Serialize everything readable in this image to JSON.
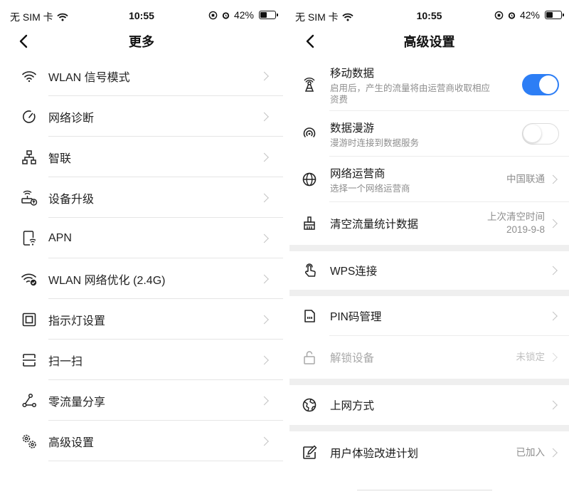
{
  "colors": {
    "accent": "#2d7ef5",
    "separator": "#efefef",
    "secondary_text": "#8e8e8e"
  },
  "left": {
    "status": {
      "carrier": "无 SIM 卡",
      "time": "10:55",
      "battery": "42%"
    },
    "title": "更多",
    "items": [
      {
        "label": "WLAN 信号模式",
        "icon": "wifi-icon"
      },
      {
        "label": "网络诊断",
        "icon": "diagnose-icon"
      },
      {
        "label": "智联",
        "icon": "topology-icon"
      },
      {
        "label": "设备升级",
        "icon": "router-upgrade-icon"
      },
      {
        "label": "APN",
        "icon": "apn-icon"
      },
      {
        "label": "WLAN 网络优化 (2.4G)",
        "icon": "wifi-optimize-icon"
      },
      {
        "label": "指示灯设置",
        "icon": "indicator-light-icon"
      },
      {
        "label": "扫一扫",
        "icon": "scan-icon"
      },
      {
        "label": "零流量分享",
        "icon": "share-icon"
      },
      {
        "label": "高级设置",
        "icon": "gears-icon"
      }
    ]
  },
  "right": {
    "status": {
      "carrier": "无 SIM 卡",
      "time": "10:55",
      "battery": "42%"
    },
    "title": "高级设置",
    "mobile_data": {
      "label": "移动数据",
      "desc": "启用后，产生的流量将由运营商收取相应资费",
      "desc_line1": "启用后，产生的流量将由运营商收取相应",
      "desc_line2": "资费",
      "enabled": true,
      "icon": "antenna-icon"
    },
    "roaming": {
      "label": "数据漫游",
      "desc": "漫游时连接到数据服务",
      "enabled": false,
      "icon": "roaming-icon"
    },
    "carrier": {
      "label": "网络运营商",
      "desc": "选择一个网络运营商",
      "value": "中国联通",
      "icon": "globe-icon"
    },
    "clear_stats": {
      "label": "清空流量统计数据",
      "value_line1": "上次清空时间",
      "value_line2": "2019-9-8",
      "icon": "broom-icon"
    },
    "wps": {
      "label": "WPS连接",
      "icon": "touch-icon"
    },
    "pin": {
      "label": "PIN码管理",
      "icon": "sim-card-icon"
    },
    "unlock": {
      "label": "解锁设备",
      "value": "未锁定",
      "icon": "unlock-icon"
    },
    "internet": {
      "label": "上网方式",
      "icon": "internet-globe-icon"
    },
    "ux": {
      "label": "用户体验改进计划",
      "value": "已加入",
      "icon": "edit-icon"
    }
  }
}
